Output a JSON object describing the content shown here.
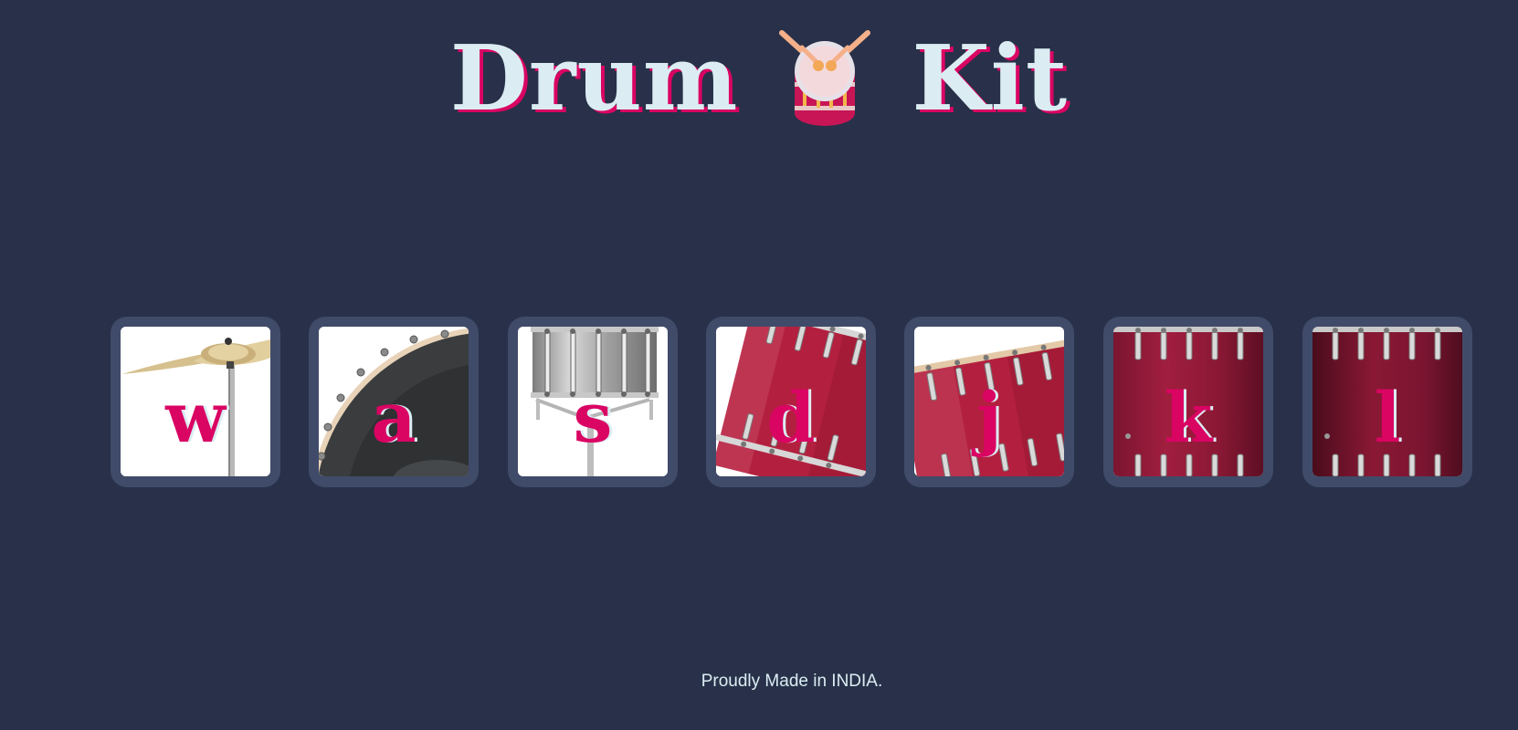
{
  "header": {
    "title_left": "Drum",
    "title_right": "Kit",
    "icon": "drum-icon"
  },
  "keys": [
    {
      "letter": "w",
      "instrument": "crash",
      "icon": "crash-cymbal-icon"
    },
    {
      "letter": "a",
      "instrument": "kick-bass",
      "icon": "kick-drum-icon"
    },
    {
      "letter": "s",
      "instrument": "snare",
      "icon": "snare-drum-icon"
    },
    {
      "letter": "d",
      "instrument": "tom-1",
      "icon": "tom-drum-icon"
    },
    {
      "letter": "j",
      "instrument": "tom-2",
      "icon": "tom-drum-icon"
    },
    {
      "letter": "k",
      "instrument": "tom-3",
      "icon": "tom-drum-icon"
    },
    {
      "letter": "l",
      "instrument": "tom-4",
      "icon": "tom-drum-icon"
    }
  ],
  "footer": {
    "text": "Proudly Made in INDIA."
  },
  "colors": {
    "background": "#283149",
    "key_frame": "#404B69",
    "accent": "#DA0463",
    "text_light": "#DBEDF3"
  }
}
